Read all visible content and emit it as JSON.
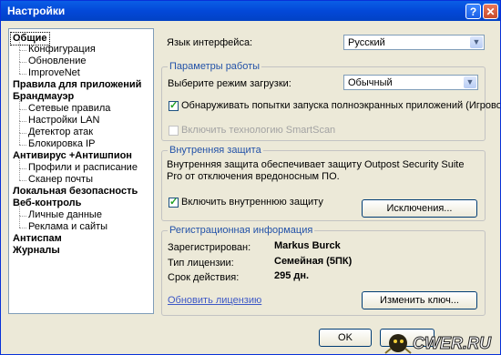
{
  "window": {
    "title": "Настройки",
    "help": "?",
    "close": "✕"
  },
  "tree": [
    {
      "label": "Общие",
      "level": 0,
      "selected": true
    },
    {
      "label": "Конфигурация",
      "level": 1
    },
    {
      "label": "Обновление",
      "level": 1
    },
    {
      "label": "ImproveNet",
      "level": 1
    },
    {
      "label": "Правила для приложений",
      "level": 0
    },
    {
      "label": "Брандмауэр",
      "level": 0
    },
    {
      "label": "Сетевые правила",
      "level": 1
    },
    {
      "label": "Настройки LAN",
      "level": 1
    },
    {
      "label": "Детектор атак",
      "level": 1
    },
    {
      "label": "Блокировка IP",
      "level": 1
    },
    {
      "label": "Антивирус +Антишпион",
      "level": 0
    },
    {
      "label": "Профили и расписание",
      "level": 1
    },
    {
      "label": "Сканер почты",
      "level": 1
    },
    {
      "label": "Локальная безопасность",
      "level": 0
    },
    {
      "label": "Веб-контроль",
      "level": 0
    },
    {
      "label": "Личные данные",
      "level": 1
    },
    {
      "label": "Реклама и сайты",
      "level": 1
    },
    {
      "label": "Антиспам",
      "level": 0
    },
    {
      "label": "Журналы",
      "level": 0
    }
  ],
  "main": {
    "lang_label": "Язык интерфейса:",
    "lang_value": "Русский",
    "work": {
      "title": "Параметры работы",
      "mode_label": "Выберите режим загрузки:",
      "mode_value": "Обычный",
      "fullscreen_label": "Обнаруживать попытки запуска полноэкранных приложений (Игровой режим)",
      "fullscreen_checked": true,
      "smartscan_label": "Включить технологию SmartScan",
      "smartscan_checked": false
    },
    "internal": {
      "title": "Внутренняя защита",
      "desc": "Внутренняя защита обеспечивает защиту Outpost Security Suite Pro от отключения вредоносным ПО.",
      "enable_label": "Включить внутреннюю защиту",
      "enable_checked": true,
      "exceptions_button": "Исключения..."
    },
    "reg": {
      "title": "Регистрационная информация",
      "registered_label": "Зарегистрирован:",
      "registered_value": "Markus Burck",
      "license_label": "Тип лицензии:",
      "license_value": "Семейная (5ПК)",
      "expiry_label": "Срок действия:",
      "expiry_value": "295 дн.",
      "update_link": "Обновить лицензию",
      "change_key_button": "Изменить ключ..."
    }
  },
  "footer": {
    "ok": "OK",
    "watermark": "CWER.RU"
  }
}
